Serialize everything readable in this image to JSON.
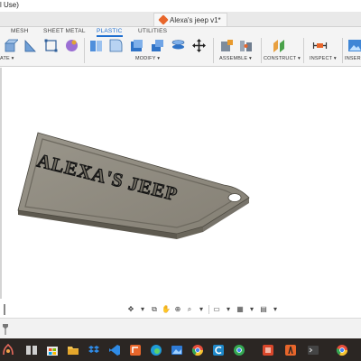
{
  "window": {
    "title_fragment": "l Use)",
    "document_tab": "Alexa's jeep v1*"
  },
  "ribbon": {
    "tabs": [
      {
        "label": "MESH",
        "active": false
      },
      {
        "label": "SHEET METAL",
        "active": false
      },
      {
        "label": "PLASTIC",
        "active": true
      },
      {
        "label": "UTILITIES",
        "active": false
      }
    ],
    "groups": {
      "create": "ATE ▾",
      "modify": "MODIFY ▾",
      "assemble": "ASSEMBLE ▾",
      "construct": "CONSTRUCT ▾",
      "inspect": "INSPECT ▾",
      "insert": "INSER"
    },
    "accent_color": "#1f6fd0"
  },
  "canvas": {
    "model_text": "ALEXA'S JEEP",
    "model_color": "#8c877c"
  },
  "taskbar": {
    "background": "#2b2623"
  }
}
